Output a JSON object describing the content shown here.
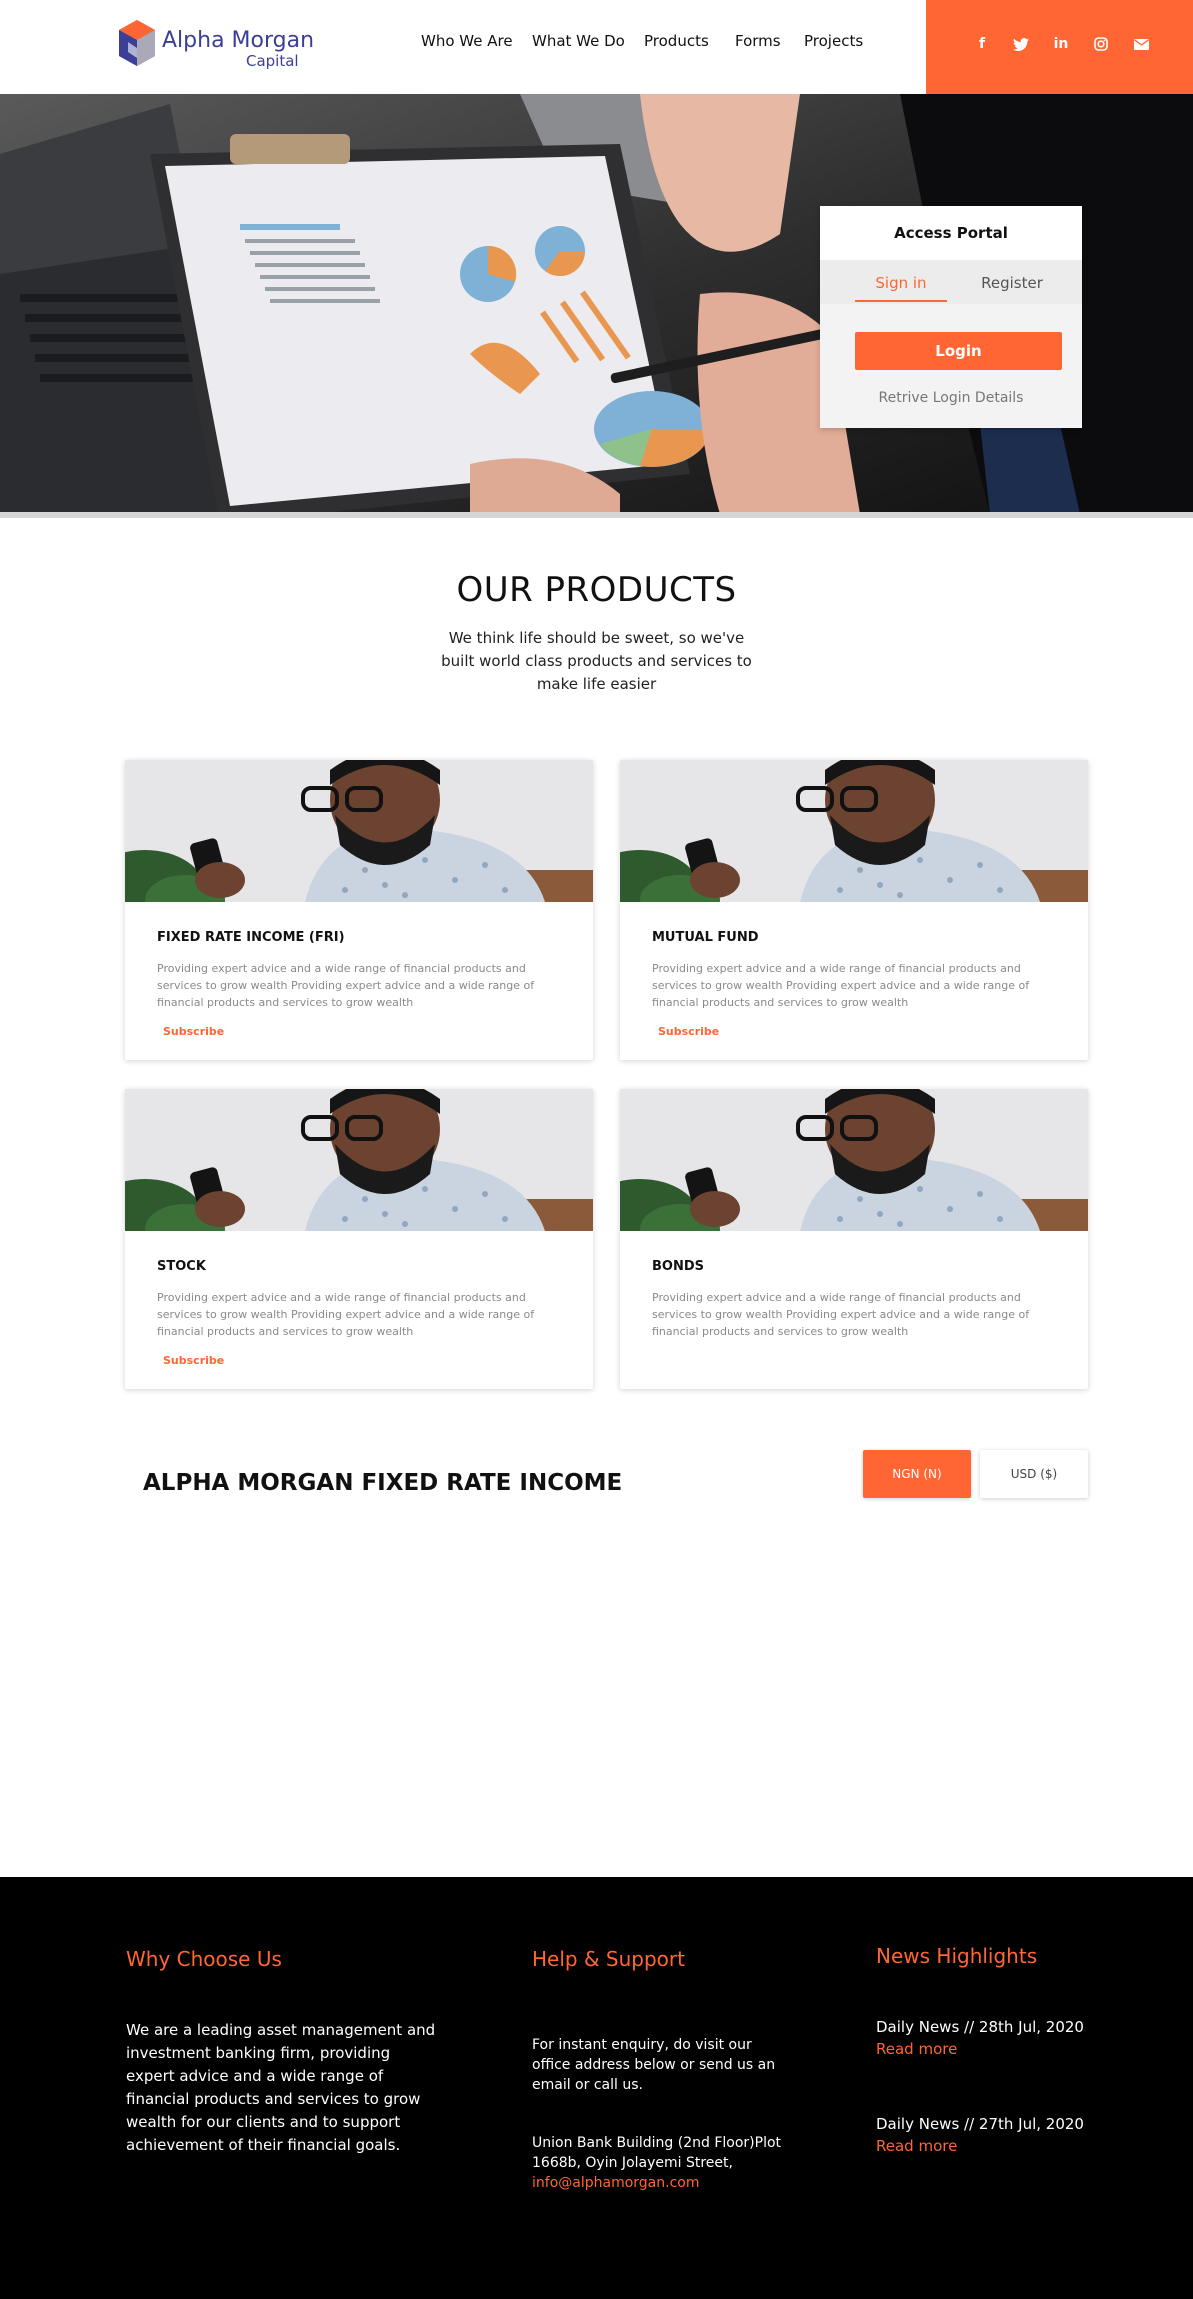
{
  "brand": {
    "name_line1": "Alpha Morgan",
    "name_line2": "Capital"
  },
  "nav": {
    "items": [
      {
        "label": "Who We Are"
      },
      {
        "label": "What We Do"
      },
      {
        "label": "Products"
      },
      {
        "label": "Forms"
      },
      {
        "label": "Projects"
      }
    ]
  },
  "social": {
    "items": [
      {
        "icon": "facebook-icon",
        "glyph": "f"
      },
      {
        "icon": "twitter-icon",
        "glyph": "🐦"
      },
      {
        "icon": "linkedin-icon",
        "glyph": "in"
      },
      {
        "icon": "instagram-icon",
        "glyph": "◎"
      },
      {
        "icon": "mail-icon",
        "glyph": "✉"
      }
    ]
  },
  "portal": {
    "title": "Access Portal",
    "tab_signin": "Sign in",
    "tab_register": "Register",
    "login_label": "Login",
    "retrieve_label": "Retrive Login Details"
  },
  "products": {
    "title": "OUR PRODUCTS",
    "subtitle": "We think life should be sweet, so we've built world class products and services to make life easier",
    "cards": [
      {
        "title": "FIXED RATE INCOME (FRI)",
        "desc": "Providing expert advice and a wide range of financial products and services to grow wealth Providing expert advice and a wide range of financial products and services to grow wealth",
        "link": "Subscribe"
      },
      {
        "title": "MUTUAL FUND",
        "desc": "Providing expert advice and a wide range of financial products and services to grow wealth Providing expert advice and a wide range of financial products and services to grow wealth",
        "link": "Subscribe"
      },
      {
        "title": "STOCK",
        "desc": "Providing expert advice and a wide range of financial products and services to grow wealth Providing expert advice and a wide range of financial products and services to grow wealth",
        "link": "Subscribe"
      },
      {
        "title": "BONDS",
        "desc": "Providing expert advice and a wide range of financial products and services to grow wealth Providing expert advice and a wide range of financial products and services to grow wealth",
        "link": ""
      }
    ]
  },
  "fri": {
    "title": "ALPHA MORGAN FIXED RATE INCOME",
    "ngn_label": "NGN (N)",
    "usd_label": "USD ($)"
  },
  "footer": {
    "why": {
      "title": "Why Choose Us",
      "text": "We are a leading asset management and investment banking firm, providing expert advice and a wide range of financial products and services to grow wealth for our clients and to support achievement of their financial goals."
    },
    "help": {
      "title": "Help & Support",
      "text": "For instant enquiry, do visit our office address below or send us an email or call us.",
      "address": "Union Bank Building (2nd Floor)Plot 1668b, Oyin Jolayemi Street,",
      "email": "info@alphamorgan.com"
    },
    "news": {
      "title": "News Highlights",
      "items": [
        {
          "headline": "Daily News // 28th Jul, 2020",
          "link": "Read more"
        },
        {
          "headline": "Daily News // 27th Jul, 2020",
          "link": "Read more"
        }
      ]
    }
  },
  "colors": {
    "accent": "#ff6633",
    "brand_blue": "#3b3f96",
    "footer_bg": "#000000"
  }
}
